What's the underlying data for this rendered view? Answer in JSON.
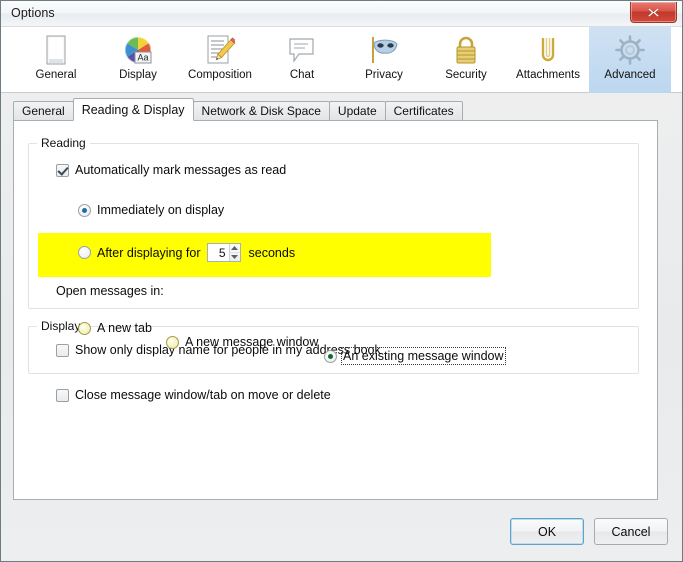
{
  "window": {
    "title": "Options",
    "close_label": "Close",
    "close_icon": "close-x-icon"
  },
  "icon_tabs": [
    {
      "label": "General",
      "icon": "document-page-icon",
      "selected": false
    },
    {
      "label": "Display",
      "icon": "color-wheel-aa-icon",
      "selected": false
    },
    {
      "label": "Composition",
      "icon": "notepad-pencil-icon",
      "selected": false
    },
    {
      "label": "Chat",
      "icon": "speech-bubble-icon",
      "selected": false
    },
    {
      "label": "Privacy",
      "icon": "mask-icon",
      "selected": false
    },
    {
      "label": "Security",
      "icon": "padlock-icon",
      "selected": false
    },
    {
      "label": "Attachments",
      "icon": "paperclip-icon",
      "selected": false
    },
    {
      "label": "Advanced",
      "icon": "gear-icon",
      "selected": true
    }
  ],
  "sub_tabs": [
    {
      "label": "General",
      "selected": false
    },
    {
      "label": "Reading & Display",
      "selected": true
    },
    {
      "label": "Network & Disk Space",
      "selected": false
    },
    {
      "label": "Update",
      "selected": false
    },
    {
      "label": "Certificates",
      "selected": false
    }
  ],
  "reading_group": {
    "title": "Reading",
    "auto_mark": {
      "label_pre": "A",
      "label_accesskey": "A",
      "label": "Automatically mark messages as read",
      "checked": true
    },
    "immediately": {
      "label": "Immediately on display",
      "checked": true
    },
    "after_displaying": {
      "label": "After displaying for",
      "checked": false,
      "seconds_value": "5",
      "seconds_label": "seconds"
    },
    "open_messages": {
      "label": "Open messages in:",
      "highlighted": true,
      "options": [
        {
          "label": "A new tab",
          "checked": false,
          "focused": false
        },
        {
          "label": "A new message window",
          "checked": false,
          "focused": false
        },
        {
          "label": "An existing message window",
          "checked": true,
          "focused": true
        }
      ]
    },
    "close_on_move": {
      "label": "Close message window/tab on move or delete",
      "checked": false
    }
  },
  "display_group": {
    "title": "Display",
    "show_display_name": {
      "label": "Show only display name for people in my address book",
      "checked": false
    }
  },
  "footer": {
    "ok_label": "OK",
    "cancel_label": "Cancel"
  },
  "colors": {
    "highlight": "#ffff00",
    "selected_tab": "#cfe2f3",
    "radio_selected": "#0b6b2e",
    "radio_blue": "#1d6fa5",
    "close_button": "#c0392c"
  }
}
